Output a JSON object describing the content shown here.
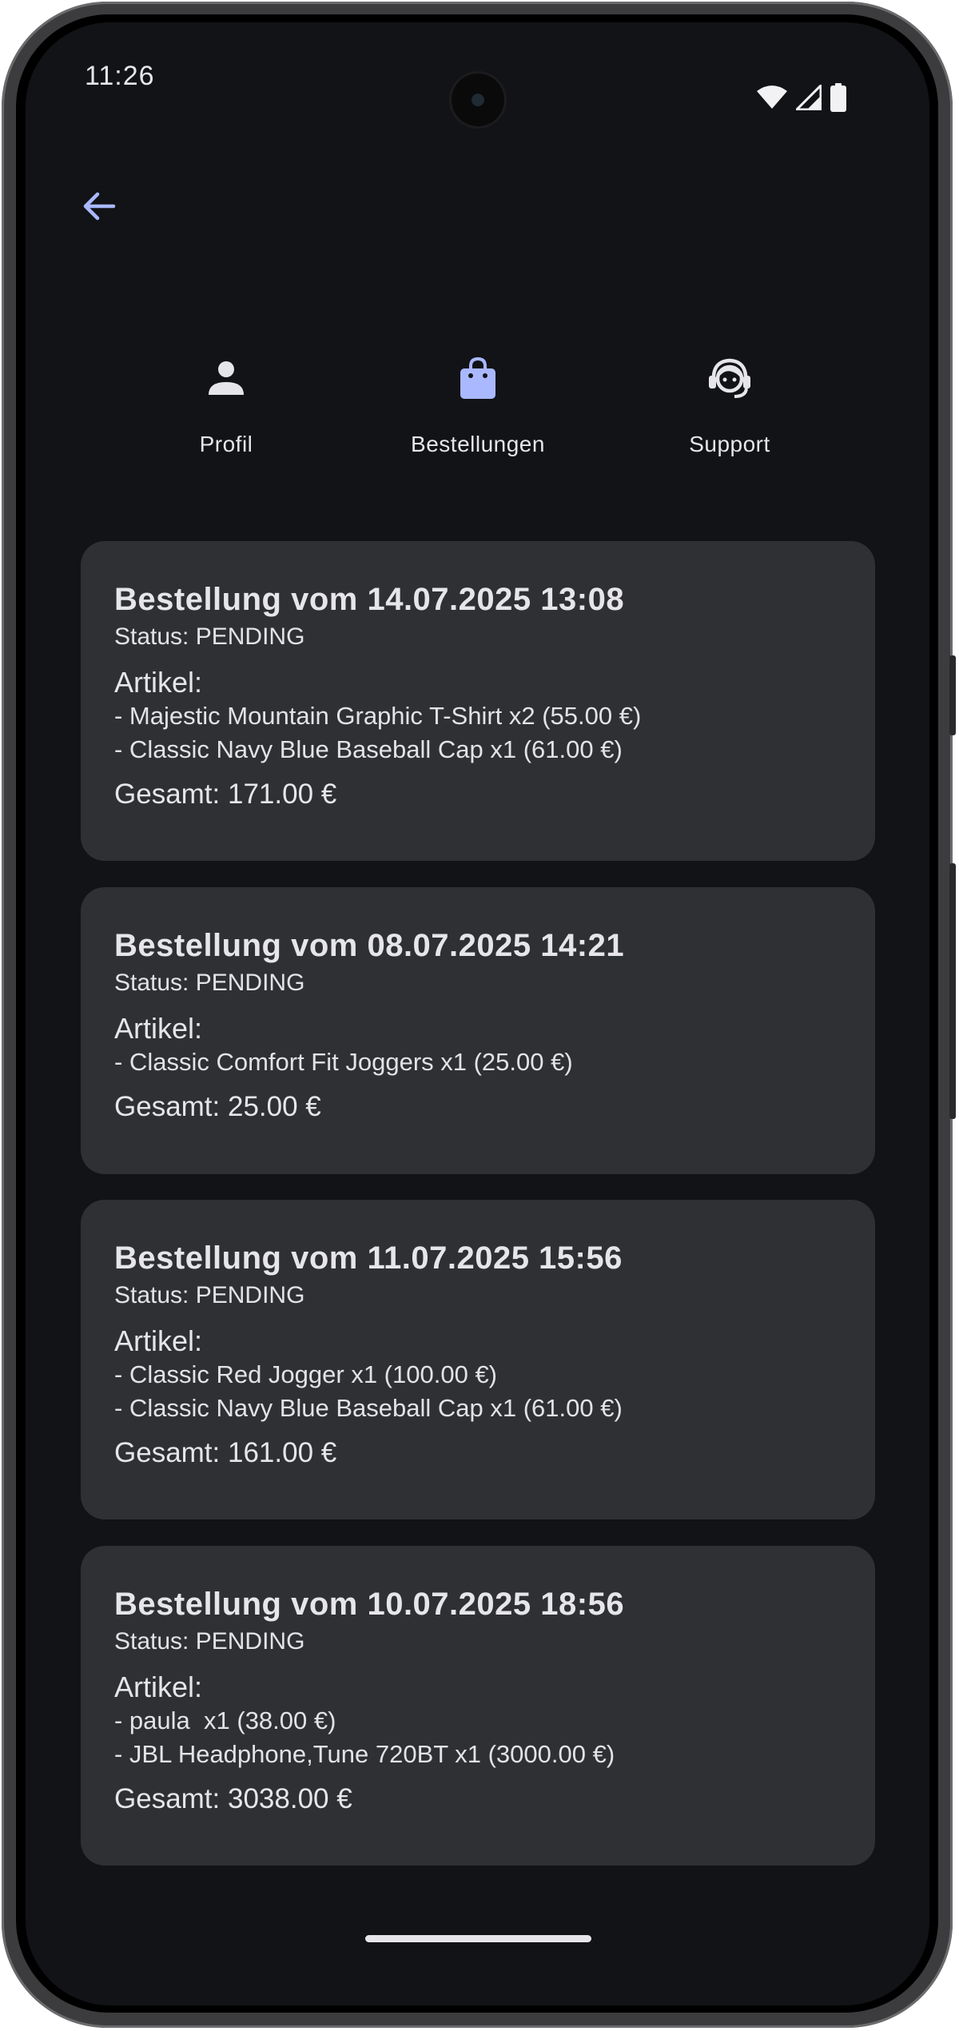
{
  "status_bar": {
    "time": "11:26",
    "icons": [
      "wifi-icon",
      "signal-icon",
      "battery-icon"
    ]
  },
  "nav": {
    "back_icon": "arrow-left-icon"
  },
  "tabs": [
    {
      "label": "Profil",
      "icon": "person-icon",
      "selected": false
    },
    {
      "label": "Bestellungen",
      "icon": "shopping-bag-icon",
      "selected": true
    },
    {
      "label": "Support",
      "icon": "support-agent-icon",
      "selected": false
    }
  ],
  "orders": [
    {
      "title": "Bestellung vom 14.07.2025 13:08",
      "status": "Status: PENDING",
      "artikel_label": "Artikel:",
      "items": [
        "- Majestic Mountain Graphic T-Shirt x2 (55.00 €)",
        "- Classic Navy Blue Baseball Cap x1 (61.00 €)"
      ],
      "total": "Gesamt: 171.00 €"
    },
    {
      "title": "Bestellung vom 08.07.2025 14:21",
      "status": "Status: PENDING",
      "artikel_label": "Artikel:",
      "items": [
        "- Classic Comfort Fit Joggers x1 (25.00 €)"
      ],
      "total": "Gesamt: 25.00 €"
    },
    {
      "title": "Bestellung vom 11.07.2025 15:56",
      "status": "Status: PENDING",
      "artikel_label": "Artikel:",
      "items": [
        "- Classic Red Jogger x1 (100.00 €)",
        "- Classic Navy Blue Baseball Cap x1 (61.00 €)"
      ],
      "total": "Gesamt: 161.00 €"
    },
    {
      "title": "Bestellung vom 10.07.2025 18:56",
      "status": "Status: PENDING",
      "artikel_label": "Artikel:",
      "items": [
        "- paula  x1 (38.00 €)",
        "- JBL Headphone,Tune 720BT x1 (3000.00 €)"
      ],
      "total": "Gesamt: 3038.00 €"
    }
  ],
  "colors": {
    "background": "#121316",
    "card": "#2f3034",
    "accent": "#a9b8ff",
    "text": "#e6e6ea"
  }
}
